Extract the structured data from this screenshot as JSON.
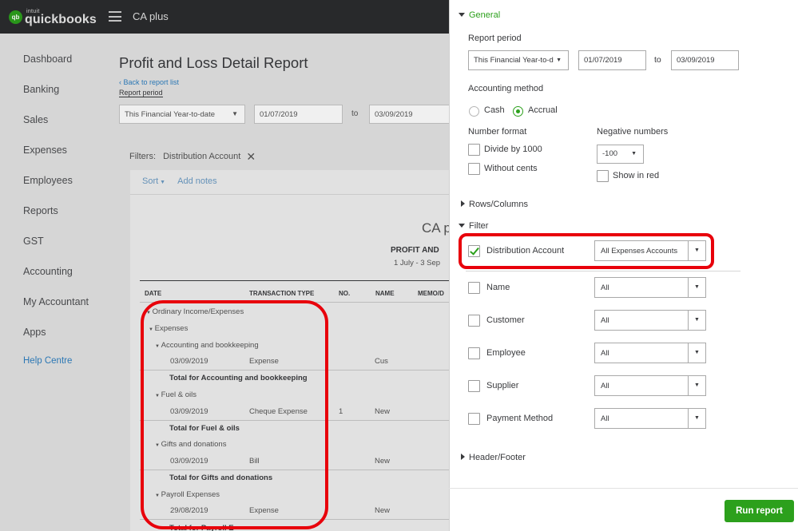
{
  "header": {
    "brand_intuit": "intuit",
    "brand_name": "quickbooks",
    "company": "CA plus",
    "logo_text": "qb"
  },
  "nav": {
    "items": [
      "Dashboard",
      "Banking",
      "Sales",
      "Expenses",
      "Employees",
      "Reports",
      "GST",
      "Accounting",
      "My Accountant",
      "Apps"
    ],
    "help": "Help Centre"
  },
  "report": {
    "title": "Profit and Loss Detail Report",
    "back_link": "Back to report list",
    "period_label": "Report period",
    "period_value": "This Financial Year-to-date",
    "from_date": "01/07/2019",
    "to_label": "to",
    "to_date": "03/09/2019",
    "filters_label": "Filters:",
    "filters_value": "Distribution Account",
    "sort_label": "Sort",
    "add_notes": "Add notes",
    "company_fragment": "CA p",
    "heading_fragment": "PROFIT AND",
    "dates_fragment": "1 July - 3 Sep",
    "columns": [
      "DATE",
      "TRANSACTION TYPE",
      "NO.",
      "NAME",
      "MEMO/D"
    ],
    "rows": [
      {
        "indent": "Ordinary Income/Expenses"
      },
      {
        "indent": "Expenses"
      },
      {
        "indent": "Accounting and bookkeeping"
      },
      {
        "date": "03/09/2019",
        "type": "Expense",
        "no": "",
        "name": "Cus"
      },
      {
        "total": "Total for Accounting and bookkeeping"
      },
      {
        "indent": "Fuel & oils"
      },
      {
        "date": "03/09/2019",
        "type": "Cheque Expense",
        "no": "1",
        "name": "New"
      },
      {
        "total": "Total for Fuel & oils"
      },
      {
        "indent": "Gifts and donations"
      },
      {
        "date": "03/09/2019",
        "type": "Bill",
        "no": "",
        "name": "New"
      },
      {
        "total": "Total for Gifts and donations"
      },
      {
        "indent": "Payroll Expenses"
      },
      {
        "date": "29/08/2019",
        "type": "Expense",
        "no": "",
        "name": "New"
      },
      {
        "total": "Total for Payroll E"
      }
    ]
  },
  "panel": {
    "general": "General",
    "report_period_label": "Report period",
    "period_value": "This Financial Year-to-date",
    "from_date": "01/07/2019",
    "to_label": "to",
    "to_date": "03/09/2019",
    "accounting_method_label": "Accounting method",
    "cash": "Cash",
    "accrual": "Accrual",
    "number_format_label": "Number format",
    "divide_1000": "Divide by 1000",
    "without_cents": "Without cents",
    "negative_numbers_label": "Negative numbers",
    "negative_value": "-100",
    "show_in_red": "Show in red",
    "rows_columns": "Rows/Columns",
    "filter": "Filter",
    "filters": [
      {
        "label": "Distribution Account",
        "value": "All Expenses Accounts",
        "checked": true
      },
      {
        "label": "Name",
        "value": "All",
        "checked": false
      },
      {
        "label": "Customer",
        "value": "All",
        "checked": false
      },
      {
        "label": "Employee",
        "value": "All",
        "checked": false
      },
      {
        "label": "Supplier",
        "value": "All",
        "checked": false
      },
      {
        "label": "Payment Method",
        "value": "All",
        "checked": false
      }
    ],
    "header_footer": "Header/Footer",
    "run_report": "Run report"
  }
}
